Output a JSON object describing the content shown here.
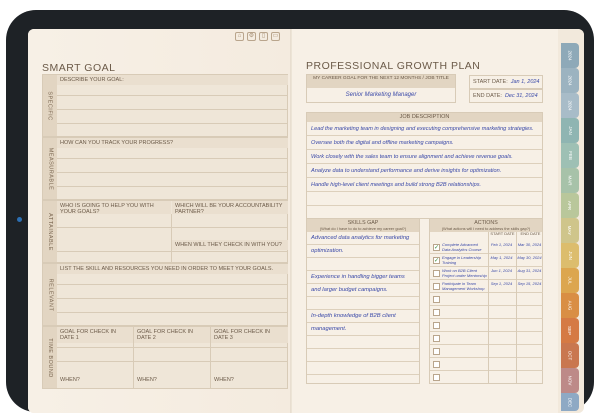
{
  "left": {
    "title": "SMART GOAL",
    "specific": {
      "side": "SPECIFIC",
      "header": "DESCRIBE YOUR GOAL:"
    },
    "measurable": {
      "side": "MEASURABLE",
      "header": "HOW CAN YOU TRACK YOUR PROGRESS?"
    },
    "attainable": {
      "side": "ATTAINABLE",
      "header1": "WHO IS GOING TO HELP YOU WITH YOUR GOALS?",
      "header2": "WHICH WILL BE YOUR ACCOUNTABILITY PARTNER?",
      "header3": "WHEN WILL THEY CHECK IN WITH YOU?"
    },
    "relevant": {
      "side": "RELEVANT",
      "header": "LIST THE SKILL AND RESOURCES YOU NEED IN ORDER TO MEET YOUR GOALS."
    },
    "timebound": {
      "side": "TIME BOUND",
      "c1": "GOAL FOR CHECK IN DATE 1",
      "c2": "GOAL FOR CHECK IN DATE 2",
      "c3": "GOAL FOR CHECK IN DATE 3",
      "when": "WHEN?"
    }
  },
  "right": {
    "title": "PROFESSIONAL GROWTH PLAN",
    "career_header": "MY CAREER GOAL FOR THE NEXT 12 MONTHS / JOB TITLE",
    "career_value": "Senior Marketing Manager",
    "start_label": "START DATE:",
    "start_value": "Jan 1, 2024",
    "end_label": "END DATE:",
    "end_value": "Dec 31, 2024",
    "job_header": "JOB DESCRIPTION",
    "job_lines": [
      "Lead the marketing team in designing and executing comprehensive marketing strategies.",
      "Oversee both the digital and offline marketing campaigns.",
      "Work closely with the sales team to ensure alignment and achieve revenue goals.",
      "Analyze data to understand performance and derive insights for optimization.",
      "Handle high-level client meetings and build strong B2B relationships."
    ],
    "skills_header": "SKILLS GAP",
    "skills_sub": "(What do I have to do to achieve my career goal?)",
    "skills_lines": [
      "Advanced data analytics for marketing",
      "optimization.",
      "",
      "Experience in handling bigger teams",
      "and larger budget campaigns.",
      "",
      "In-depth knowledge of B2B client",
      "management."
    ],
    "actions_header": "ACTIONS",
    "actions_sub": "(What actions will I need to address the skills gap?)",
    "start_col": "START DATE",
    "end_col": "END DATE",
    "actions": [
      {
        "text": "Complete Advanced Data Analytics Course",
        "start": "Feb 1, 2024",
        "end": "Mar 30, 2024",
        "checked": true
      },
      {
        "text": "Engage in Leadership Training",
        "start": "May 1, 2024",
        "end": "May 30, 2024",
        "checked": true
      },
      {
        "text": "Work on B2B Client Project under Mentorship",
        "start": "Jun 1, 2024",
        "end": "Aug 31, 2024",
        "checked": false
      },
      {
        "text": "Participate in Team Management Workshop",
        "start": "Sep 1, 2024",
        "end": "Sep 15, 2024",
        "checked": false
      }
    ]
  },
  "tabs": [
    {
      "label": "2024",
      "color": "#8ea9b8"
    },
    {
      "label": "2024",
      "color": "#9cb3c0"
    },
    {
      "label": "2024",
      "color": "#a8bcc8"
    },
    {
      "label": "JAN",
      "color": "#8fb5b2"
    },
    {
      "label": "FEB",
      "color": "#9ec0b4"
    },
    {
      "label": "MAR",
      "color": "#a7c2a9"
    },
    {
      "label": "APR",
      "color": "#b9c79b"
    },
    {
      "label": "MAY",
      "color": "#cfc58b"
    },
    {
      "label": "JUN",
      "color": "#dcbd6d"
    },
    {
      "label": "JUL",
      "color": "#dca64f"
    },
    {
      "label": "AUG",
      "color": "#d98e44"
    },
    {
      "label": "SEP",
      "color": "#d57a44"
    },
    {
      "label": "OCT",
      "color": "#c9774f"
    },
    {
      "label": "NOV",
      "color": "#bd8a88"
    },
    {
      "label": "DEC",
      "color": "#8ea9c4"
    }
  ]
}
